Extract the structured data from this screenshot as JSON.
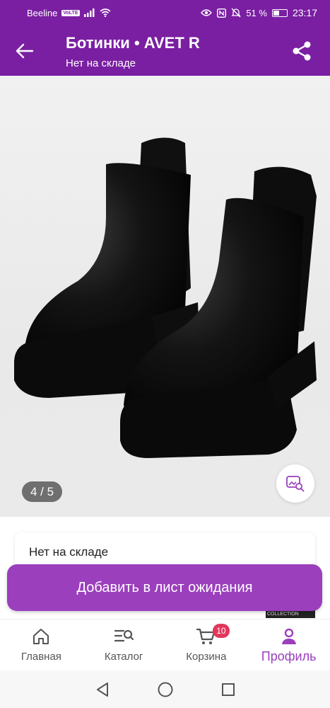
{
  "status_bar": {
    "carrier": "Beeline",
    "network_badge": "VoLTE",
    "battery": "51 %",
    "battery_level": 0.51,
    "time": "23:17"
  },
  "app_bar": {
    "title": "Ботинки • AVET R",
    "subtitle": "Нет на складе",
    "back_icon": "arrow-left-icon",
    "share_icon": "share-icon"
  },
  "gallery": {
    "counter": "4 / 5",
    "current": 4,
    "total": 5,
    "image_tag": "COLLECTION"
  },
  "stock": {
    "status": "Нет на складе"
  },
  "actions": {
    "waitlist_label": "Добавить в лист ожидания"
  },
  "bottom_nav": {
    "items": [
      {
        "label": "Главная",
        "icon": "home-icon"
      },
      {
        "label": "Каталог",
        "icon": "catalog-search-icon"
      },
      {
        "label": "Корзина",
        "icon": "cart-icon",
        "badge": "10"
      },
      {
        "label": "Профиль",
        "icon": "profile-icon"
      }
    ]
  },
  "colors": {
    "brand": "#7a1fa2",
    "button": "#9b3fbd",
    "badge": "#e2365a"
  }
}
